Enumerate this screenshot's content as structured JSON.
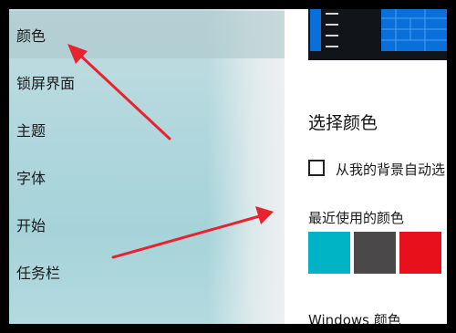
{
  "sidebar": {
    "items": [
      {
        "label": "颜色",
        "selected": true
      },
      {
        "label": "锁屏界面"
      },
      {
        "label": "主题"
      },
      {
        "label": "字体"
      },
      {
        "label": "开始"
      },
      {
        "label": "任务栏"
      }
    ]
  },
  "content": {
    "title": "选择颜色",
    "auto_pick_checkbox": {
      "label": "从我的背景自动选",
      "checked": false
    },
    "recent_colors_label": "最近使用的颜色",
    "recent_colors": [
      "#00b4c6",
      "#4a4848",
      "#e8111b"
    ],
    "windows_colors_label": "Windows 颜色"
  },
  "colors": {
    "accent_blue": "#0a6fd8",
    "annotation_arrow": "#e8222e"
  }
}
